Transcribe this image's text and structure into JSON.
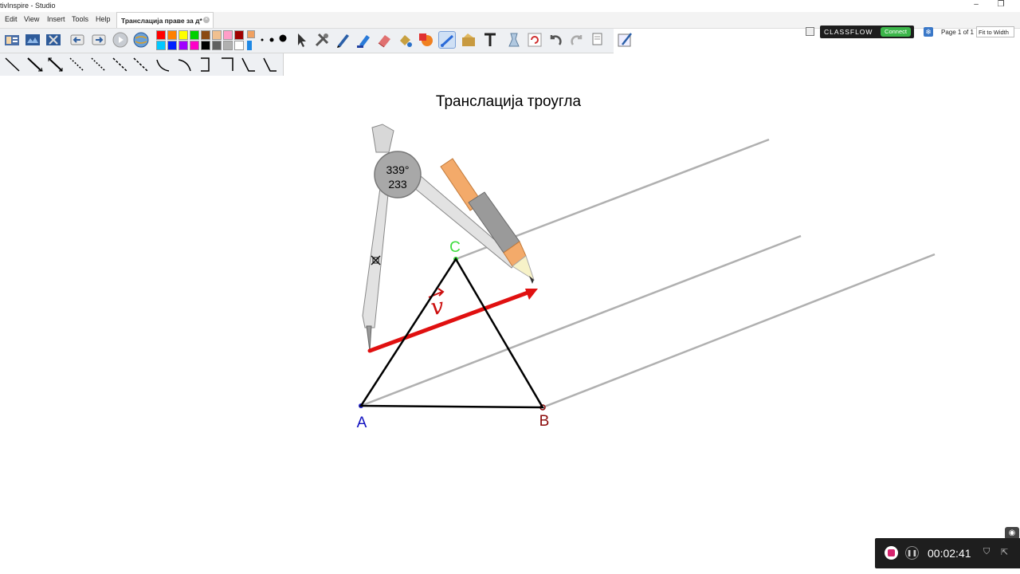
{
  "window": {
    "title": "tivInspire - Studio",
    "minimize_glyph": "–",
    "restore_glyph": "❐"
  },
  "menu": [
    "Edit",
    "View",
    "Insert",
    "Tools",
    "Help"
  ],
  "document_tab": {
    "label": "Трансл­ација праве за д*",
    "close_glyph": "×"
  },
  "classflow": {
    "label": "CLASSFLOW",
    "connect": "Connect"
  },
  "page_indicator": "Page 1 of 1",
  "zoom": "Fit to Width",
  "colors": {
    "palette_row1": [
      "#ff0000",
      "#ff8000",
      "#ffff00",
      "#00d000",
      "#8b4a14",
      "#f0c090",
      "#ff9ec8",
      "#a00000"
    ],
    "palette_row2": [
      "#00c8ff",
      "#0020ff",
      "#a000ff",
      "#ff00c8",
      "#000000",
      "#606060",
      "#b0b0b0",
      "#ffffff"
    ],
    "triangle": "#000000",
    "guide_lines": "#b0b0b0",
    "vector": "#e01010",
    "label_A": "#1010c0",
    "label_B": "#8b0a0a",
    "label_C": "#3ddc3d"
  },
  "toolbar_icons": [
    "flipchart-browser-icon",
    "browser-icon",
    "resource-icon",
    "previous-page-icon",
    "next-page-icon",
    "play-icon",
    "globe-icon",
    "select-icon",
    "tools-icon",
    "pen-icon",
    "highlighter-icon",
    "eraser-icon",
    "fill-icon",
    "shape-icon",
    "connector-icon",
    "magic-ink-icon",
    "text-icon",
    "clear-icon",
    "reset-icon",
    "undo-icon",
    "redo-icon",
    "page-icon",
    "recognition-icon"
  ],
  "line_styles_count": 13,
  "canvas": {
    "title": "Транслација троугла",
    "point_a": "A",
    "point_b": "B",
    "point_c": "C",
    "vector_label": "v",
    "compass_angle": "339°",
    "compass_length": "233"
  },
  "recorder": {
    "time": "00:02:41"
  }
}
